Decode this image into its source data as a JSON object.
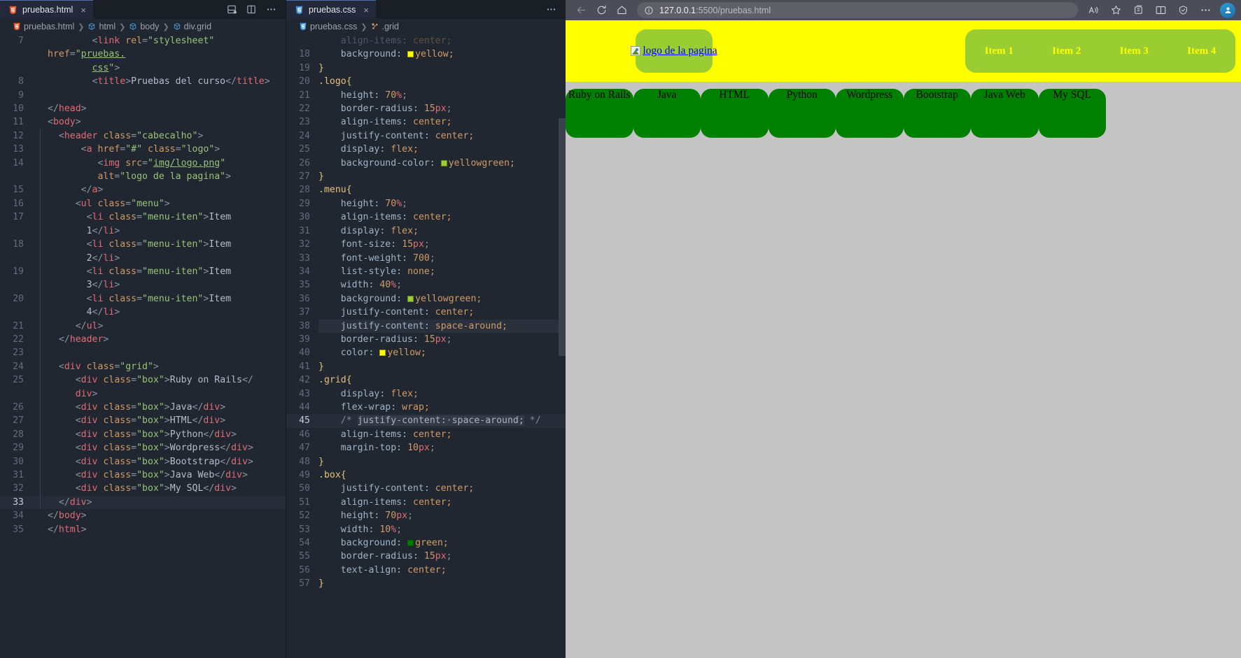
{
  "vscode": {
    "left_pane": {
      "tab": {
        "label": "pruebas.html",
        "icon": "html5-icon",
        "close": "×"
      },
      "breadcrumb": [
        "pruebas.html",
        "html",
        "body",
        "div.grid"
      ],
      "actions": [
        "split-editor-down-icon",
        "split-editor-right-icon",
        "more-actions-icon"
      ],
      "lines": [
        {
          "n": "7",
          "guides": 0,
          "active": false
        },
        {
          "n": "",
          "guides": 0,
          "active": false
        },
        {
          "n": "8",
          "guides": 0,
          "active": false
        },
        {
          "n": "9",
          "guides": 0,
          "active": false
        },
        {
          "n": "10",
          "guides": 0,
          "active": false
        },
        {
          "n": "11",
          "guides": 0,
          "active": false
        },
        {
          "n": "12",
          "guides": 1,
          "active": false
        },
        {
          "n": "13",
          "guides": 1,
          "active": false
        },
        {
          "n": "14",
          "guides": 1,
          "active": false
        },
        {
          "n": "",
          "guides": 1,
          "active": false
        },
        {
          "n": "15",
          "guides": 1,
          "active": false
        },
        {
          "n": "16",
          "guides": 1,
          "active": false
        },
        {
          "n": "17",
          "guides": 2,
          "active": false
        },
        {
          "n": "",
          "guides": 2,
          "active": false
        },
        {
          "n": "18",
          "guides": 2,
          "active": false
        },
        {
          "n": "",
          "guides": 2,
          "active": false
        },
        {
          "n": "19",
          "guides": 2,
          "active": false
        },
        {
          "n": "",
          "guides": 2,
          "active": false
        },
        {
          "n": "20",
          "guides": 2,
          "active": false
        },
        {
          "n": "",
          "guides": 2,
          "active": false
        },
        {
          "n": "21",
          "guides": 1,
          "active": false
        },
        {
          "n": "22",
          "guides": 1,
          "active": false
        },
        {
          "n": "23",
          "guides": 1,
          "active": false
        },
        {
          "n": "24",
          "guides": 1,
          "active": false
        },
        {
          "n": "25",
          "guides": 2,
          "active": false
        },
        {
          "n": "",
          "guides": 2,
          "active": false
        },
        {
          "n": "26",
          "guides": 2,
          "active": false
        },
        {
          "n": "27",
          "guides": 2,
          "active": false
        },
        {
          "n": "28",
          "guides": 2,
          "active": false
        },
        {
          "n": "29",
          "guides": 2,
          "active": false
        },
        {
          "n": "30",
          "guides": 2,
          "active": false
        },
        {
          "n": "31",
          "guides": 2,
          "active": false
        },
        {
          "n": "32",
          "guides": 2,
          "active": false
        },
        {
          "n": "33",
          "guides": 1,
          "active": true
        },
        {
          "n": "34",
          "guides": 0,
          "active": false
        },
        {
          "n": "35",
          "guides": 0,
          "active": false
        }
      ],
      "code_text": {
        "l7a": "<link rel=\"stylesheet\" href=\"pruebas.",
        "l7b": "css\">",
        "l8": "<title>Pruebas del curso</title>",
        "l10": "</head>",
        "l11": "<body>",
        "l12": "<header class=\"cabecalho\">",
        "l13": "<a href=\"#\" class=\"logo\">",
        "l14a": "<img src=\"img/logo.png\"",
        "l14b": "alt=\"logo de la pagina\">",
        "l15": "</a>",
        "l16": "<ul class=\"menu\">",
        "l17a": "<li class=\"menu-iten\">Item",
        "l17b": "1</li>",
        "l18a": "<li class=\"menu-iten\">Item",
        "l18b": "2</li>",
        "l19a": "<li class=\"menu-iten\">Item",
        "l19b": "3</li>",
        "l20a": "<li class=\"menu-iten\">Item",
        "l20b": "4</li>",
        "l21": "</ul>",
        "l22": "</header>",
        "l24": "<div class=\"grid\">",
        "l25a": "<div class=\"box\">Ruby on Rails</",
        "l25b": "div>",
        "l26": "<div class=\"box\">Java</div>",
        "l27": "<div class=\"box\">HTML</div>",
        "l28": "<div class=\"box\">Python</div>",
        "l29": "<div class=\"box\">Wordpress</div>",
        "l30": "<div class=\"box\">Bootstrap</div>",
        "l31": "<div class=\"box\">Java Web</div>",
        "l32": "<div class=\"box\">My SQL</div>",
        "l33": "</div>",
        "l34": "</body>",
        "l35": "</html>"
      }
    },
    "right_pane": {
      "tab": {
        "label": "pruebas.css",
        "icon": "css3-icon",
        "close": "×"
      },
      "breadcrumb": [
        "pruebas.css",
        ".grid"
      ],
      "actions": [
        "more-actions-icon"
      ],
      "lines": [
        {
          "n": "17",
          "active": false
        },
        {
          "n": "18",
          "active": false
        },
        {
          "n": "19",
          "active": false
        },
        {
          "n": "20",
          "active": false
        },
        {
          "n": "21",
          "active": false
        },
        {
          "n": "22",
          "active": false
        },
        {
          "n": "23",
          "active": false
        },
        {
          "n": "24",
          "active": false
        },
        {
          "n": "25",
          "active": false
        },
        {
          "n": "26",
          "active": false
        },
        {
          "n": "27",
          "active": false
        },
        {
          "n": "28",
          "active": false
        },
        {
          "n": "29",
          "active": false
        },
        {
          "n": "30",
          "active": false
        },
        {
          "n": "31",
          "active": false
        },
        {
          "n": "32",
          "active": false
        },
        {
          "n": "33",
          "active": false
        },
        {
          "n": "34",
          "active": false
        },
        {
          "n": "35",
          "active": false
        },
        {
          "n": "36",
          "active": false
        },
        {
          "n": "37",
          "active": false
        },
        {
          "n": "38",
          "active": false
        },
        {
          "n": "39",
          "active": false
        },
        {
          "n": "40",
          "active": false
        },
        {
          "n": "41",
          "active": false
        },
        {
          "n": "42",
          "active": false
        },
        {
          "n": "43",
          "active": false
        },
        {
          "n": "44",
          "active": false
        },
        {
          "n": "45",
          "active": true
        },
        {
          "n": "46",
          "active": false
        },
        {
          "n": "47",
          "active": false
        },
        {
          "n": "48",
          "active": false
        },
        {
          "n": "49",
          "active": false
        },
        {
          "n": "50",
          "active": false
        },
        {
          "n": "51",
          "active": false
        },
        {
          "n": "52",
          "active": false
        },
        {
          "n": "53",
          "active": false
        },
        {
          "n": "54",
          "active": false
        },
        {
          "n": "55",
          "active": false
        },
        {
          "n": "56",
          "active": false
        },
        {
          "n": "57",
          "active": false
        }
      ],
      "code_text": {
        "l17_partial": "align-items: center;",
        "l18_prop": "background:",
        "l18_val": "yellow;",
        "l19": "}",
        "l20": ".logo{",
        "l21_prop": "height:",
        "l21_num": "70",
        "l21_unit": "%",
        "l22_prop": "border-radius:",
        "l22_num": "15",
        "l22_unit": "px",
        "l23_prop": "align-items:",
        "l23_val": "center;",
        "l24_prop": "justify-content:",
        "l24_val": "center;",
        "l25_prop": "display:",
        "l25_val": "flex;",
        "l26_prop": "background-color:",
        "l26_val": "yellowgreen;",
        "l27": "}",
        "l28": ".menu{",
        "l29_prop": "height:",
        "l29_num": "70",
        "l29_unit": "%",
        "l30_prop": "align-items:",
        "l30_val": "center;",
        "l31_prop": "display:",
        "l31_val": "flex;",
        "l32_prop": "font-size:",
        "l32_num": "15",
        "l32_unit": "px",
        "l33_prop": "font-weight:",
        "l33_num": "700",
        "l34_prop": "list-style:",
        "l34_val": "none;",
        "l35_prop": "width:",
        "l35_num": "40",
        "l35_unit": "%",
        "l36_prop": "background:",
        "l36_val": "yellowgreen;",
        "l37_prop": "justify-content:",
        "l37_val": "center;",
        "l38_prop": "justify-content:",
        "l38_val": "space-around;",
        "l39_prop": "border-radius:",
        "l39_num": "15",
        "l39_unit": "px",
        "l40_prop": "color:",
        "l40_val": "yellow;",
        "l41": "}",
        "l42": ".grid{",
        "l43_prop": "display:",
        "l43_val": "flex;",
        "l44_prop": "flex-wrap:",
        "l44_val": "wrap;",
        "l45_open": "/*",
        "l45_body": "justify-content: space-around;",
        "l45_close": "*/",
        "l46_prop": "align-items:",
        "l46_val": "center;",
        "l47_prop": "margin-top:",
        "l47_num": "10",
        "l47_unit": "px",
        "l48": "}",
        "l49": ".box{",
        "l50_prop": "justify-content:",
        "l50_val": "center;",
        "l51_prop": "align-items:",
        "l51_val": "center;",
        "l52_prop": "height:",
        "l52_num": "70",
        "l52_unit": "px",
        "l53_prop": "width:",
        "l53_num": "10",
        "l53_unit": "%",
        "l54_prop": "background:",
        "l54_val": "green;",
        "l55_prop": "border-radius:",
        "l55_num": "15",
        "l55_unit": "px",
        "l56_prop": "text-align:",
        "l56_val": "center;",
        "l57": "}"
      },
      "color_swatches": {
        "yellow": "#ffff00",
        "yellowgreen": "#9acd32",
        "green": "#008000"
      }
    }
  },
  "browser": {
    "toolbar": {
      "back": "back-arrow-icon",
      "reload": "reload-icon",
      "home": "home-icon",
      "info": "info-icon",
      "url_host": "127.0.0.1",
      "url_rest": ":5500/pruebas.html",
      "read_aloud": "read-aloud-icon",
      "favorite": "star-icon",
      "collections": "collections-icon",
      "split_screen": "split-screen-icon",
      "browser_essentials": "browser-essentials-icon",
      "settings": "settings-more-icon",
      "profile": "profile-avatar-icon"
    },
    "page": {
      "logo_alt": "logo de la pagina",
      "menu_items": [
        "Item 1",
        "Item 2",
        "Item 3",
        "Item 4"
      ],
      "boxes": [
        "Ruby on Rails",
        "Java",
        "HTML",
        "Python",
        "Wordpress",
        "Bootstrap",
        "Java Web",
        "My SQL"
      ],
      "colors": {
        "header_bg": "#ffff00",
        "logo_bg": "#9acd32",
        "menu_bg": "#9acd32",
        "menu_text": "#ffff00",
        "box_bg": "#008000",
        "page_bg": "#c4c4c4"
      }
    }
  }
}
